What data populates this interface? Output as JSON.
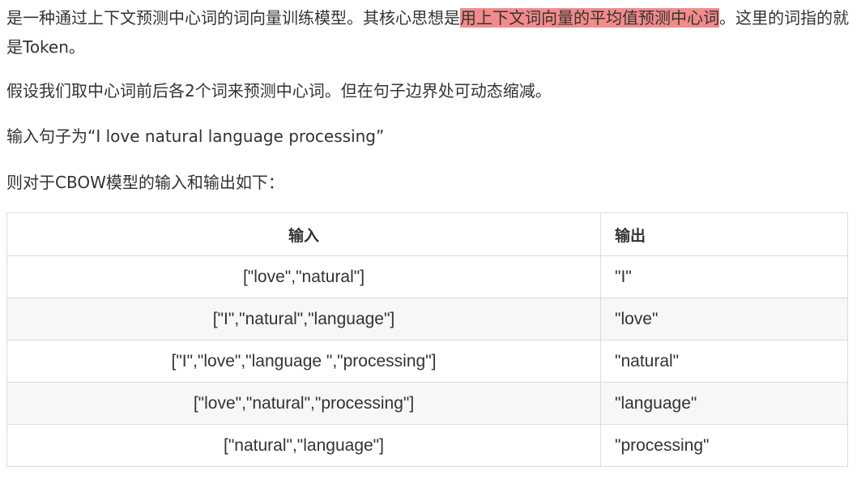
{
  "paragraphs": {
    "p1_before": "是一种通过上下文预测中心词的词向量训练模型。其核心思想是",
    "p1_highlight": "用上下文词向量的平均值预测中心词",
    "p1_after": "。这里的词指的就是Token。",
    "p2": "假设我们取中心词前后各2个词来预测中心词。但在句子边界处可动态缩减。",
    "p3": "输入句子为“I love natural language processing”",
    "p4": "则对于CBOW模型的输入和输出如下："
  },
  "table": {
    "headers": [
      "输入",
      "输出"
    ],
    "rows": [
      {
        "input": "[\"love\",\"natural\"]",
        "output": "\"I\""
      },
      {
        "input": "[\"I\",\"natural\",\"language\"]",
        "output": "\"love\""
      },
      {
        "input": "[\"I\",\"love\",\"language \",\"processing\"]",
        "output": "\"natural\""
      },
      {
        "input": "[\"love\",\"natural\",\"processing\"]",
        "output": "\"language\""
      },
      {
        "input": "[\"natural\",\"language\"]",
        "output": "\"processing\""
      }
    ]
  },
  "colors": {
    "highlight": "#f38b8b",
    "text": "#333333",
    "table_border": "#dcdcdc",
    "stripe": "#f7f7f7"
  }
}
